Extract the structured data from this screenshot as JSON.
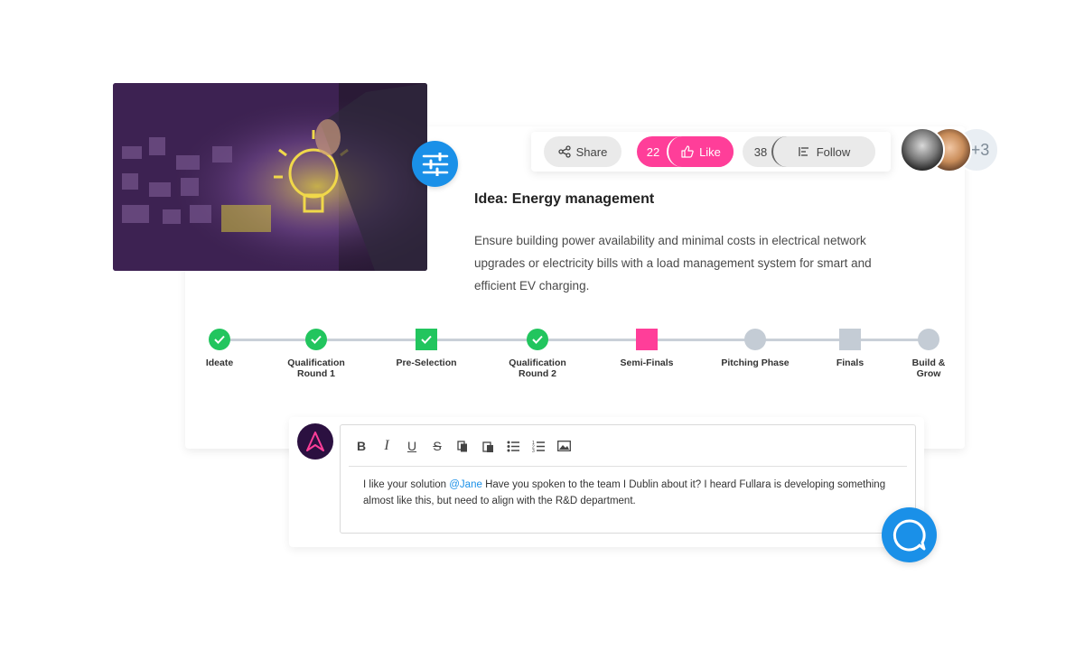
{
  "idea": {
    "title": "Idea: Energy management",
    "description": "Ensure building power availability and minimal costs in electrical network upgrades or electricity bills with a load management system for smart and efficient EV charging."
  },
  "actions": {
    "share_label": "Share",
    "like_count": "22",
    "like_label": "Like",
    "follow_count": "38",
    "follow_label": "Follow"
  },
  "followers": {
    "extra_count": "+3"
  },
  "stages": [
    {
      "label": "Ideate",
      "status": "done"
    },
    {
      "label": "Qualification Round 1",
      "status": "done"
    },
    {
      "label": "Pre-Selection",
      "status": "done"
    },
    {
      "label": "Qualification Round 2",
      "status": "done"
    },
    {
      "label": "Semi-Finals",
      "status": "active"
    },
    {
      "label": "Pitching Phase",
      "status": "pending"
    },
    {
      "label": "Finals",
      "status": "pending"
    },
    {
      "label": "Build & Grow",
      "status": "pending"
    }
  ],
  "stage_labels": {
    "s1": "Ideate",
    "s2a": "Qualification",
    "s2b": "Round 1",
    "s3": "Pre-Selection",
    "s4a": "Qualification",
    "s4b": "Round 2",
    "s5": "Semi-Finals",
    "s6": "Pitching Phase",
    "s7": "Finals",
    "s8a": "Build &",
    "s8b": "Grow"
  },
  "comment": {
    "before_mention": "I like your solution ",
    "mention": "@Jane",
    "after_mention": " Have you spoken to the team I Dublin about it? I heard Fullara is developing something almost like this, but need to align with the R&D department."
  },
  "toolbar": {
    "bold": "B",
    "italic": "I",
    "underline": "U",
    "strike": "S"
  },
  "colors": {
    "accent_blue": "#1a90e8",
    "accent_pink": "#ff3e99",
    "done_green": "#22c55e",
    "pending_gray": "#c4ccd5"
  }
}
